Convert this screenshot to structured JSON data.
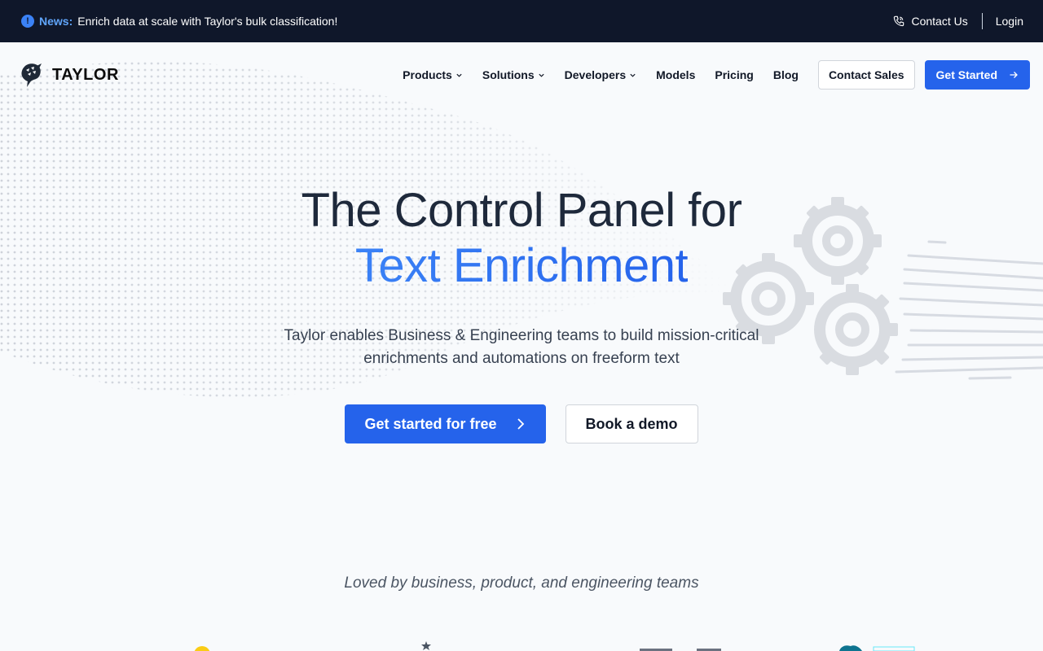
{
  "announcement": {
    "news_label": "News:",
    "news_text": "Enrich data at scale with Taylor's bulk classification!",
    "contact_us": "Contact Us",
    "login": "Login"
  },
  "nav": {
    "brand": "TAYLOR",
    "links": [
      {
        "label": "Products",
        "has_dropdown": true
      },
      {
        "label": "Solutions",
        "has_dropdown": true
      },
      {
        "label": "Developers",
        "has_dropdown": true
      },
      {
        "label": "Models",
        "has_dropdown": false
      },
      {
        "label": "Pricing",
        "has_dropdown": false
      },
      {
        "label": "Blog",
        "has_dropdown": false
      }
    ],
    "contact_sales": "Contact Sales",
    "get_started": "Get Started"
  },
  "hero": {
    "title_line1": "The Control Panel for",
    "title_line2": "Text Enrichment",
    "subtitle": "Taylor enables Business & Engineering teams to build mission-critical enrichments and automations on freeform text",
    "primary_cta": "Get started for free",
    "secondary_cta": "Book a demo"
  },
  "social_proof": {
    "tagline": "Loved by business, product, and engineering teams"
  },
  "colors": {
    "accent": "#2563eb",
    "topbar_bg": "#0f172a",
    "news_accent": "#60a5fa",
    "page_bg": "#f8fafc"
  },
  "icons": {
    "news": "info-circle-icon",
    "contact": "phone-icon",
    "brand": "dolphin-logo-icon",
    "dropdown": "chevron-down-icon",
    "get_started": "arrow-right-icon",
    "primary_cta": "chevron-right-icon",
    "decor": "gear-icon"
  }
}
